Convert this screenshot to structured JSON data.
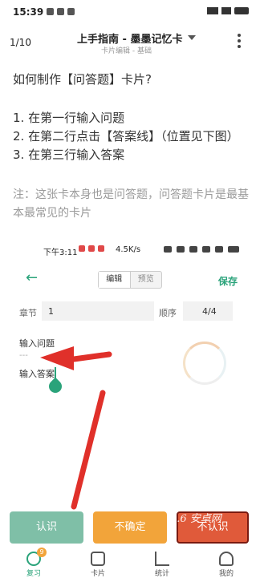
{
  "status_bar": {
    "time": "15:39"
  },
  "header": {
    "counter": "1/10",
    "title": "上手指南 - 墨墨记忆卡",
    "subtitle": "卡片编辑 - 基础"
  },
  "content": {
    "question": "如何制作【问答题】卡片?",
    "steps": [
      "1. 在第一行输入问题",
      "2. 在第二行点击【答案线】（位置见下图）",
      "3. 在第三行输入答案"
    ],
    "note": "注：这张卡本身也是问答题，问答题卡片是最基本最常见的卡片"
  },
  "embedded_screenshot": {
    "status_time": "下午3:11",
    "network_speed": "4.5K/s",
    "tabs": {
      "edit": "编辑",
      "preview": "预览"
    },
    "save_label": "保存",
    "chapter_label": "章节",
    "chapter_value": "1",
    "order_label": "顺序",
    "order_value": "4/4",
    "field_question": "输入问题",
    "answer_line": "---",
    "field_answer": "输入答案"
  },
  "buttons": {
    "know": "认识",
    "unsure": "不确定",
    "unknown": "不认识"
  },
  "watermark": "9.6 安卓网",
  "nav": {
    "review_badge": "9",
    "items": [
      "复习",
      "卡片",
      "统计",
      "我的"
    ]
  },
  "colors": {
    "accent": "#2aa37a",
    "arrow": "#e0302a",
    "know": "#7fbfa7",
    "unsure": "#f2a43a",
    "unknown": "#e05a3a"
  }
}
